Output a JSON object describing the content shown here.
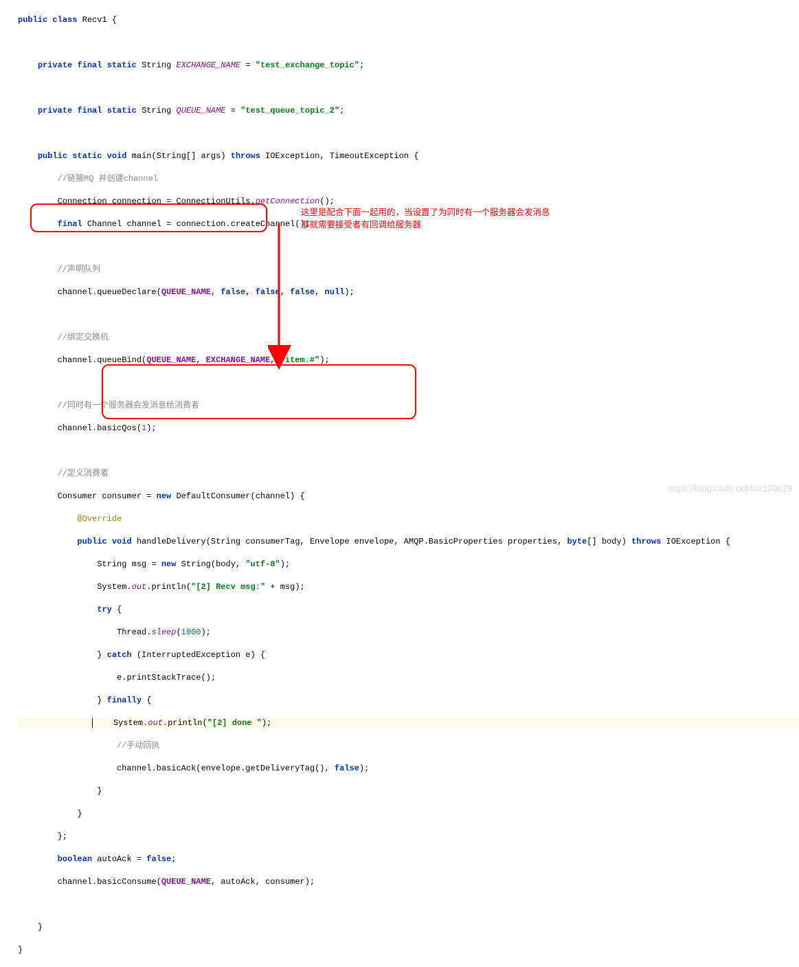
{
  "kw": {
    "public": "public",
    "class": "class",
    "private": "private",
    "final": "final",
    "static": "static",
    "void": "void",
    "throws": "throws",
    "new": "new",
    "false": "false",
    "null": "null",
    "try": "try",
    "catch": "catch",
    "finally": "finally",
    "boolean": "boolean",
    "byte": "byte"
  },
  "cls": {
    "Recv1": "Recv1",
    "String": "String",
    "IOException": "IOException",
    "TimeoutException": "TimeoutException",
    "Connection": "Connection",
    "ConnectionUtils": "ConnectionUtils",
    "Channel": "Channel",
    "Consumer": "Consumer",
    "DefaultConsumer": "DefaultConsumer",
    "Envelope": "Envelope",
    "AMQP": "AMQP",
    "BasicProperties": "BasicProperties",
    "Thread": "Thread",
    "InterruptedException": "InterruptedException"
  },
  "ids": {
    "EXCHANGE_NAME": "EXCHANGE_NAME",
    "QUEUE_NAME": "QUEUE_NAME",
    "main": "main",
    "args": "args",
    "connection": "connection",
    "channel": "channel",
    "consumer": "consumer",
    "handleDelivery": "handleDelivery",
    "consumerTag": "consumerTag",
    "envelope": "envelope",
    "properties": "properties",
    "body": "body",
    "msg": "msg",
    "e": "e",
    "autoAck": "autoAck",
    "out": "out",
    "getConnection": "getConnection",
    "createChannel": "createChannel",
    "queueDeclare": "queueDeclare",
    "queueBind": "queueBind",
    "basicQos": "basicQos",
    "println": "println",
    "sleep": "sleep",
    "printStackTrace": "printStackTrace",
    "basicAck": "basicAck",
    "getDeliveryTag": "getDeliveryTag",
    "basicConsume": "basicConsume"
  },
  "str": {
    "ex": "\"test_exchange_topic\"",
    "qu": "\"test_queue_topic_2\"",
    "itemhash": "\"item.#\"",
    "utf8": "\"utf-8\"",
    "recvmsg": "\"[2] Recv msg:\"",
    "done": "\"[2] done \""
  },
  "num": {
    "one": "1",
    "thousand": "1000"
  },
  "cmt": {
    "c1": "//链接MQ 并创建channel",
    "c2": "//声明队列",
    "c3": "//绑定交换机",
    "c4": "//同时有一个服务器会发消息给消费者",
    "c5": "//定义消费者",
    "c6": "//手动回执"
  },
  "ann": {
    "override": "@Override"
  },
  "note": {
    "l1": "这里是配合下面一起用的，当设置了为同时有一个服务器会发消息",
    "l2": "那就需要接受者有回调给服务器"
  },
  "watermark": "https://blog.csdn.net/fox100629"
}
